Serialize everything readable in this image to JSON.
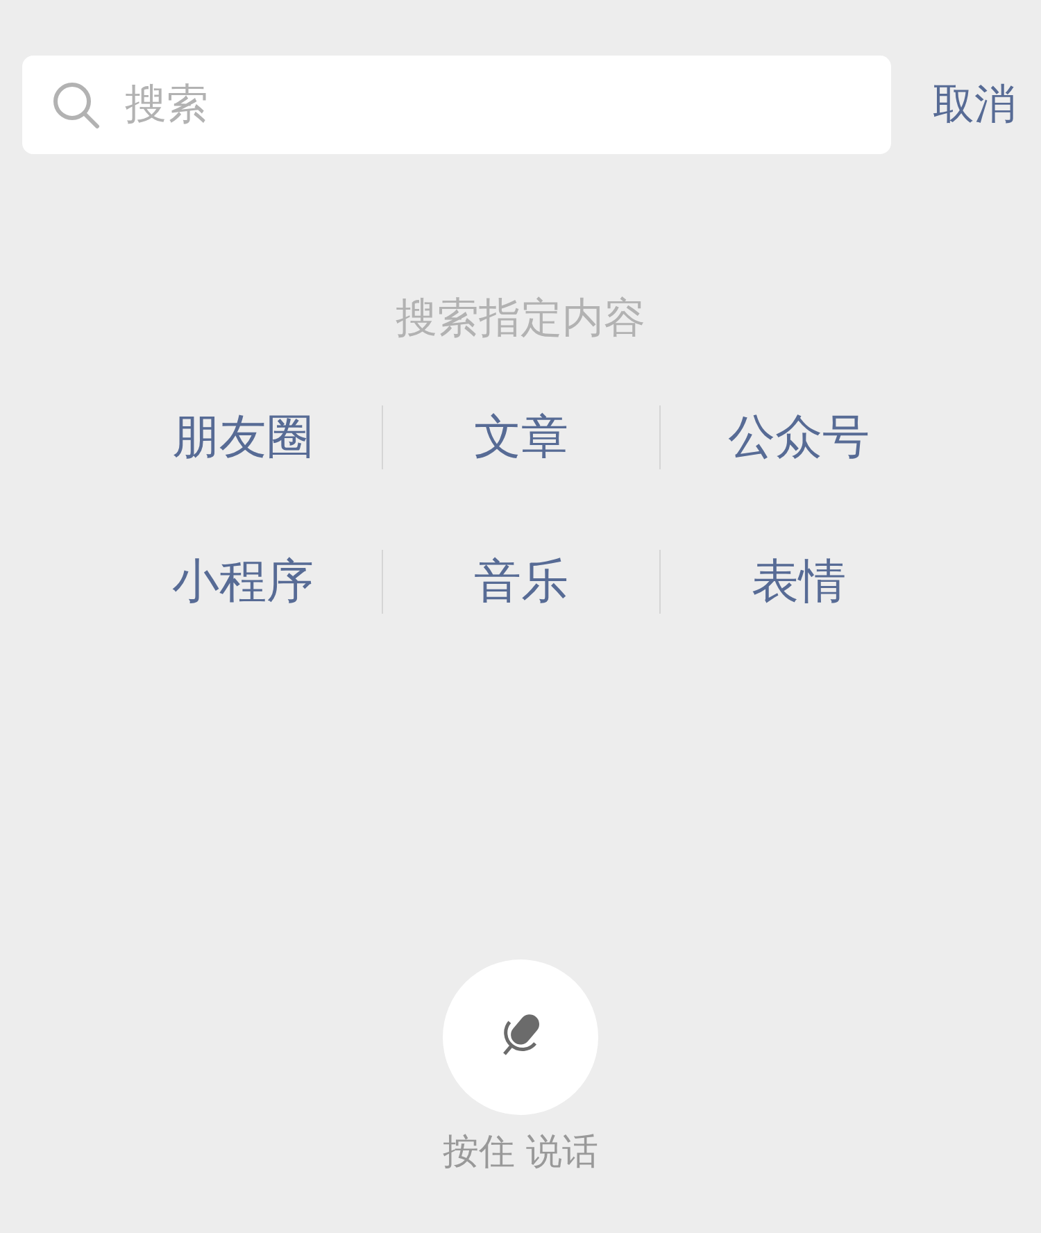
{
  "search": {
    "placeholder": "搜索"
  },
  "cancel": "取消",
  "hint": "搜索指定内容",
  "categories": [
    [
      "朋友圈",
      "文章",
      "公众号"
    ],
    [
      "小程序",
      "音乐",
      "表情"
    ]
  ],
  "voice": {
    "label": "按住 说话"
  }
}
